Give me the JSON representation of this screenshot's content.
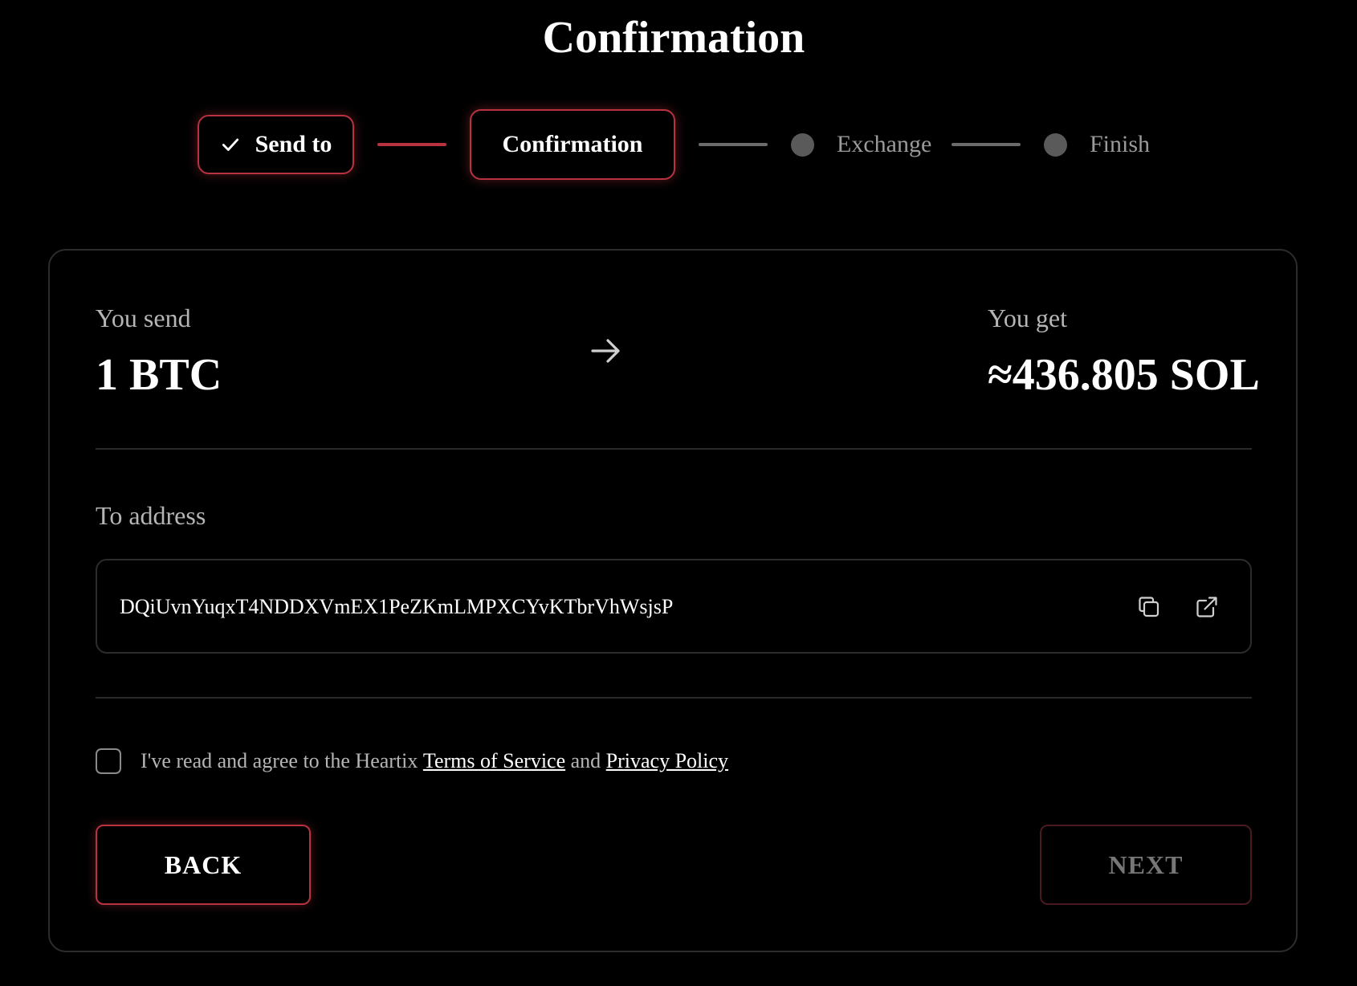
{
  "page": {
    "title": "Confirmation"
  },
  "stepper": {
    "steps": [
      {
        "label": "Send to",
        "state": "completed"
      },
      {
        "label": "Confirmation",
        "state": "active"
      },
      {
        "label": "Exchange",
        "state": "pending"
      },
      {
        "label": "Finish",
        "state": "pending"
      }
    ]
  },
  "summary": {
    "send_label": "You send",
    "send_amount": "1 BTC",
    "get_label": "You get",
    "get_amount": "≈436.805 SOL",
    "arrow_icon": "arrow-right-icon"
  },
  "address": {
    "label": "To address",
    "value": "DQiUvnYuqxT4NDDXVmEX1PeZKmLMPXCYvKTbrVhWsjsP",
    "copy_icon": "copy-icon",
    "open_icon": "external-link-icon"
  },
  "agreement": {
    "checked": false,
    "text_before": "I've read and agree to the Heartix ",
    "terms_link": "Terms of Service",
    "text_middle": " and ",
    "privacy_link": "Privacy Policy"
  },
  "actions": {
    "back_label": "BACK",
    "next_label": "NEXT",
    "next_disabled": true
  },
  "colors": {
    "accent": "#b8323f",
    "background": "#000000",
    "muted_text": "#b5b5b5",
    "inactive_step": "#5a5a5a"
  }
}
